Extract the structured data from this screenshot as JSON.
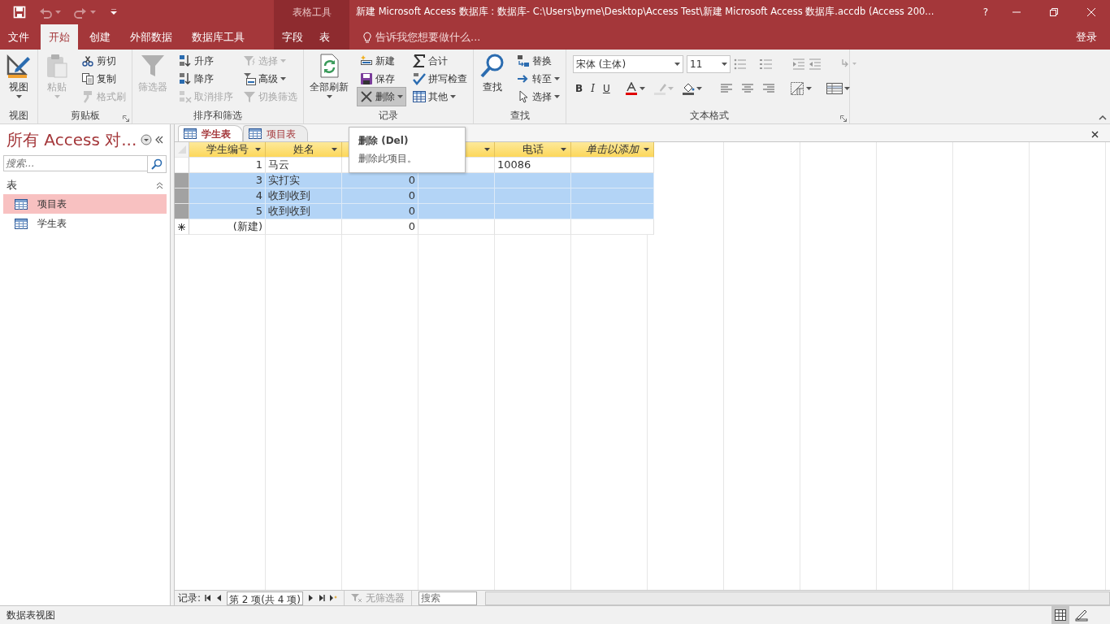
{
  "window": {
    "title": "新建 Microsoft Access 数据库 : 数据库- C:\\Users\\byme\\Desktop\\Access Test\\新建 Microsoft Access 数据库.accdb (Access 200...",
    "context_label": "表格工具",
    "help": "?"
  },
  "quick_access": [
    {
      "kind": "save",
      "disabled": false
    },
    {
      "kind": "undo",
      "disabled": true
    },
    {
      "kind": "redo",
      "disabled": true
    }
  ],
  "ribbon_tabs": [
    {
      "label": "文件",
      "selected": false,
      "kind": "main"
    },
    {
      "label": "开始",
      "selected": true,
      "kind": "main"
    },
    {
      "label": "创建",
      "selected": false,
      "kind": "main"
    },
    {
      "label": "外部数据",
      "selected": false,
      "kind": "main"
    },
    {
      "label": "数据库工具",
      "selected": false,
      "kind": "main"
    },
    {
      "label": "字段",
      "selected": false,
      "kind": "context"
    },
    {
      "label": "表",
      "selected": false,
      "kind": "context"
    }
  ],
  "tell_me": {
    "placeholder": "告诉我您想要做什么..."
  },
  "sign_in": "登录",
  "ribbon_groups": [
    {
      "label": "视图",
      "kind": "commands",
      "launcher": false,
      "commands": [
        {
          "label": "视图",
          "kind": "large",
          "dropdown": true,
          "disabled": false,
          "highlighted": false
        }
      ]
    },
    {
      "label": "剪贴板",
      "kind": "commands",
      "launcher": true,
      "commands": [
        {
          "label": "粘贴",
          "kind": "large",
          "dropdown": true,
          "disabled": true,
          "highlighted": false
        },
        {
          "label": "剪切",
          "kind": "small",
          "dropdown": false,
          "disabled": false,
          "highlighted": false
        },
        {
          "label": "复制",
          "kind": "small",
          "dropdown": false,
          "disabled": false,
          "highlighted": false
        },
        {
          "label": "格式刷",
          "kind": "small",
          "dropdown": false,
          "disabled": true,
          "highlighted": false
        }
      ]
    },
    {
      "label": "排序和筛选",
      "kind": "commands",
      "launcher": false,
      "commands": [
        {
          "label": "筛选器",
          "kind": "large",
          "dropdown": false,
          "disabled": true,
          "highlighted": false
        },
        {
          "label": "升序",
          "kind": "small",
          "dropdown": false,
          "disabled": false,
          "highlighted": false
        },
        {
          "label": "降序",
          "kind": "small",
          "dropdown": false,
          "disabled": false,
          "highlighted": false
        },
        {
          "label": "取消排序",
          "kind": "small",
          "dropdown": false,
          "disabled": true,
          "highlighted": false
        },
        {
          "label": "选择",
          "kind": "small",
          "dropdown": true,
          "disabled": true,
          "highlighted": false
        },
        {
          "label": "高级",
          "kind": "small",
          "dropdown": true,
          "disabled": false,
          "highlighted": false
        },
        {
          "label": "切换筛选",
          "kind": "small",
          "dropdown": false,
          "disabled": true,
          "highlighted": false
        }
      ]
    },
    {
      "label": "记录",
      "kind": "commands",
      "launcher": false,
      "commands": [
        {
          "label": "全部刷新",
          "kind": "large",
          "dropdown": true,
          "disabled": false,
          "highlighted": false
        },
        {
          "label": "新建",
          "kind": "small",
          "dropdown": false,
          "disabled": false,
          "highlighted": false
        },
        {
          "label": "保存",
          "kind": "small",
          "dropdown": false,
          "disabled": false,
          "highlighted": false
        },
        {
          "label": "删除",
          "kind": "small",
          "dropdown": true,
          "disabled": false,
          "highlighted": true
        },
        {
          "label": "合计",
          "kind": "small",
          "dropdown": false,
          "disabled": false,
          "highlighted": false
        },
        {
          "label": "拼写检查",
          "kind": "small",
          "dropdown": false,
          "disabled": false,
          "highlighted": false
        },
        {
          "label": "其他",
          "kind": "small",
          "dropdown": true,
          "disabled": false,
          "highlighted": false
        }
      ]
    },
    {
      "label": "查找",
      "kind": "commands",
      "launcher": false,
      "commands": [
        {
          "label": "查找",
          "kind": "large",
          "dropdown": false,
          "disabled": false,
          "highlighted": false
        },
        {
          "label": "替换",
          "kind": "small",
          "dropdown": false,
          "disabled": false,
          "highlighted": false
        },
        {
          "label": "转至",
          "kind": "small",
          "dropdown": true,
          "disabled": false,
          "highlighted": false
        },
        {
          "label": "选择",
          "kind": "small",
          "dropdown": true,
          "disabled": false,
          "highlighted": false
        }
      ]
    },
    {
      "label": "文本格式",
      "kind": "text-format",
      "launcher": true,
      "font": "宋体 (主体)",
      "size": "11",
      "styles": [
        "B",
        "I",
        "U"
      ]
    }
  ],
  "tooltip": {
    "title": "删除 (Del)",
    "text": "删除此项目。"
  },
  "nav_pane": {
    "title": "所有 Access 对...",
    "search_placeholder": "搜索...",
    "section": "表",
    "items": [
      {
        "label": "项目表",
        "selected": true
      },
      {
        "label": "学生表",
        "selected": false
      }
    ]
  },
  "doc_tabs": [
    {
      "label": "学生表",
      "selected": true
    },
    {
      "label": "项目表",
      "selected": false
    }
  ],
  "table": {
    "columns": [
      {
        "label": "学生编号",
        "kind": "field"
      },
      {
        "label": "姓名",
        "kind": "field"
      },
      {
        "kind": "field"
      },
      {
        "kind": "field"
      },
      {
        "label": "电话",
        "kind": "field"
      },
      {
        "label": "单击以添加",
        "kind": "add"
      }
    ],
    "rows": [
      {
        "kind": "record",
        "selected": false,
        "cells": [
          "1",
          "马云",
          null,
          null,
          "10086",
          null
        ]
      },
      {
        "kind": "record",
        "selected": true,
        "cells": [
          "3",
          "实打实",
          "0",
          null,
          null,
          null
        ]
      },
      {
        "kind": "record",
        "selected": true,
        "cells": [
          "4",
          "收到收到",
          "0",
          null,
          null,
          null
        ]
      },
      {
        "kind": "record",
        "selected": true,
        "cells": [
          "5",
          "收到收到",
          "0",
          null,
          null,
          null
        ]
      },
      {
        "kind": "new",
        "selected": false,
        "cells": [
          "(新建)",
          null,
          "0",
          null,
          null,
          null
        ]
      }
    ]
  },
  "record_nav": {
    "label": "记录:",
    "position": "第 2 项(共 4 项)",
    "filter": "无筛选器",
    "search_placeholder": "搜索"
  },
  "status_bar": {
    "text": "数据表视图",
    "views": [
      {
        "selected": true
      },
      {
        "selected": false
      }
    ]
  }
}
